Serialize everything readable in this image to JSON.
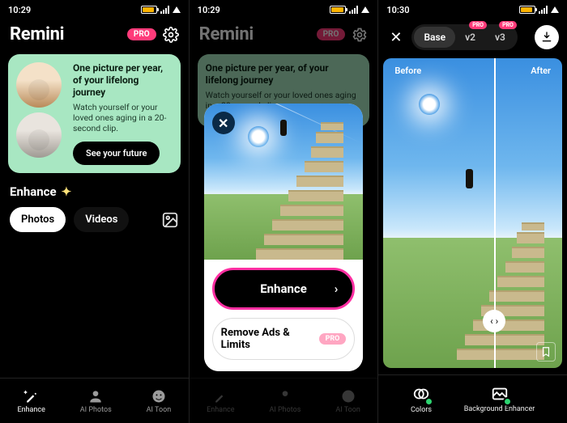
{
  "status": {
    "time1": "10:29",
    "time2": "10:29",
    "time3": "10:30",
    "battery": "89"
  },
  "app": {
    "title": "Remini",
    "pro": "PRO"
  },
  "promo": {
    "title": "One picture per year, of your lifelong journey",
    "sub": "Watch yourself or your loved ones aging in a 20-second clip.",
    "cta": "See your future"
  },
  "enhance_section": {
    "label": "Enhance"
  },
  "chips": {
    "photos": "Photos",
    "videos": "Videos"
  },
  "nav": {
    "enhance": "Enhance",
    "aiphotos": "AI Photos",
    "aitoon": "AI Toon"
  },
  "sheet": {
    "enhance": "Enhance",
    "remove": "Remove Ads & Limits",
    "pro": "PRO"
  },
  "s3": {
    "seg": {
      "base": "Base",
      "v2": "v2",
      "v3": "v3",
      "pro": "PRO"
    },
    "before": "Before",
    "after": "After",
    "nav": {
      "colors": "Colors",
      "bg": "Background Enhancer"
    }
  }
}
